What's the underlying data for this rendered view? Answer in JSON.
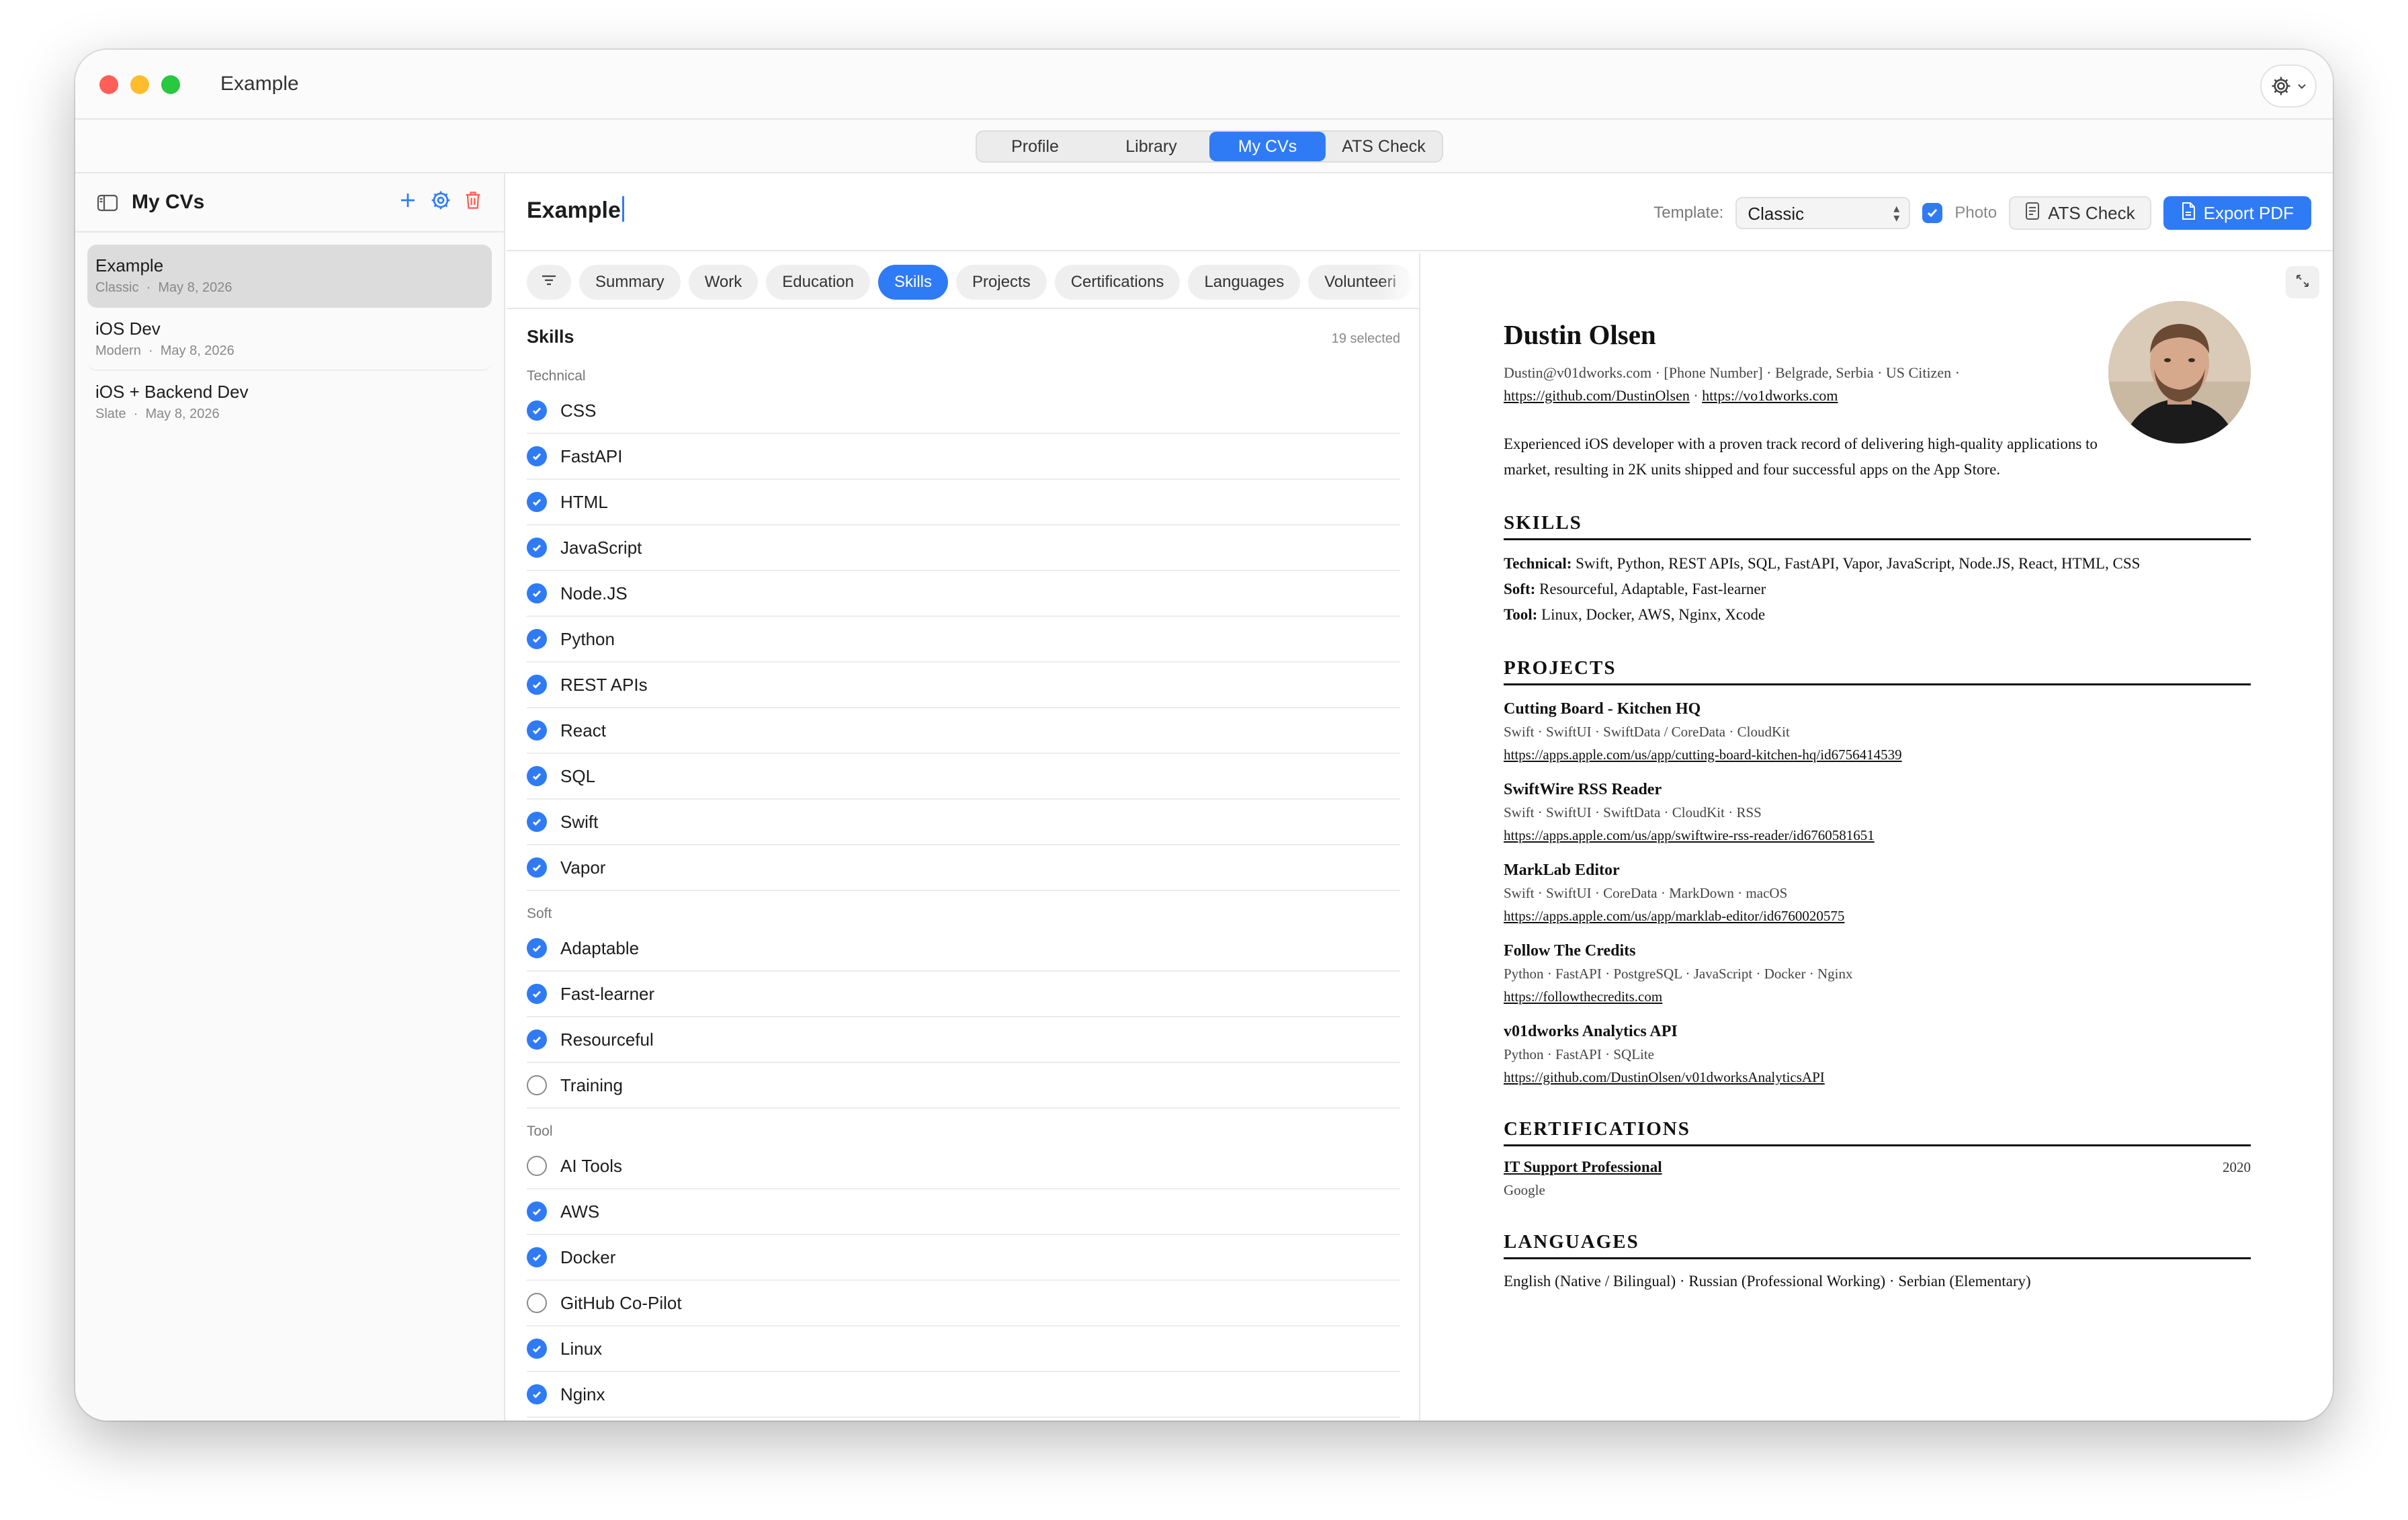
{
  "window": {
    "title": "Example"
  },
  "nav": {
    "segments": [
      {
        "label": "Profile",
        "active": false
      },
      {
        "label": "Library",
        "active": false
      },
      {
        "label": "My CVs",
        "active": true
      },
      {
        "label": "ATS Check",
        "active": false
      }
    ]
  },
  "sidebar": {
    "title": "My CVs",
    "items": [
      {
        "name": "Example",
        "template": "Classic",
        "date": "May 8, 2026",
        "selected": true
      },
      {
        "name": "iOS Dev",
        "template": "Modern",
        "date": "May 8, 2026",
        "selected": false
      },
      {
        "name": "iOS + Backend Dev",
        "template": "Slate",
        "date": "May 8, 2026",
        "selected": false
      }
    ],
    "meta_separator": "·"
  },
  "header": {
    "doc_title": "Example",
    "template_label": "Template:",
    "template_value": "Classic",
    "photo_label": "Photo",
    "photo_checked": true,
    "ats_button": "ATS Check",
    "export_button": "Export PDF"
  },
  "tabs": [
    {
      "label": "Summary",
      "active": false
    },
    {
      "label": "Work",
      "active": false
    },
    {
      "label": "Education",
      "active": false
    },
    {
      "label": "Skills",
      "active": true
    },
    {
      "label": "Projects",
      "active": false
    },
    {
      "label": "Certifications",
      "active": false
    },
    {
      "label": "Languages",
      "active": false
    },
    {
      "label": "Volunteeri",
      "active": false
    }
  ],
  "skills_panel": {
    "title": "Skills",
    "selected_count": "19 selected",
    "groups": [
      {
        "label": "Technical",
        "skills": [
          {
            "name": "CSS",
            "checked": true
          },
          {
            "name": "FastAPI",
            "checked": true
          },
          {
            "name": "HTML",
            "checked": true
          },
          {
            "name": "JavaScript",
            "checked": true
          },
          {
            "name": "Node.JS",
            "checked": true
          },
          {
            "name": "Python",
            "checked": true
          },
          {
            "name": "REST APIs",
            "checked": true
          },
          {
            "name": "React",
            "checked": true
          },
          {
            "name": "SQL",
            "checked": true
          },
          {
            "name": "Swift",
            "checked": true
          },
          {
            "name": "Vapor",
            "checked": true
          }
        ]
      },
      {
        "label": "Soft",
        "skills": [
          {
            "name": "Adaptable",
            "checked": true
          },
          {
            "name": "Fast-learner",
            "checked": true
          },
          {
            "name": "Resourceful",
            "checked": true
          },
          {
            "name": "Training",
            "checked": false
          }
        ]
      },
      {
        "label": "Tool",
        "skills": [
          {
            "name": "AI Tools",
            "checked": false
          },
          {
            "name": "AWS",
            "checked": true
          },
          {
            "name": "Docker",
            "checked": true
          },
          {
            "name": "GitHub Co-Pilot",
            "checked": false
          },
          {
            "name": "Linux",
            "checked": true
          },
          {
            "name": "Nginx",
            "checked": true
          }
        ]
      }
    ]
  },
  "cv_preview": {
    "name": "Dustin Olsen",
    "contact_line": "Dustin@v01dworks.com · [Phone Number] · Belgrade, Serbia · US Citizen ·",
    "github": "https://github.com/DustinOlsen",
    "website": "https://vo1dworks.com",
    "link_separator": " · ",
    "summary": "Experienced iOS developer with a proven track record of delivering high-quality applications to market, resulting in 2K units shipped and four successful apps on the App Store.",
    "skills_title": "SKILLS",
    "skill_lines": [
      {
        "label": "Technical:",
        "value": "Swift, Python, REST APIs, SQL, FastAPI, Vapor, JavaScript, Node.JS, React, HTML, CSS"
      },
      {
        "label": "Soft:",
        "value": "Resourceful, Adaptable, Fast-learner"
      },
      {
        "label": "Tool:",
        "value": "Linux, Docker, AWS, Nginx, Xcode"
      }
    ],
    "projects_title": "PROJECTS",
    "projects": [
      {
        "name": "Cutting Board - Kitchen HQ",
        "tech": "Swift · SwiftUI · SwiftData / CoreData · CloudKit",
        "url": "https://apps.apple.com/us/app/cutting-board-kitchen-hq/id6756414539"
      },
      {
        "name": "SwiftWire RSS Reader",
        "tech": "Swift · SwiftUI · SwiftData · CloudKit · RSS",
        "url": "https://apps.apple.com/us/app/swiftwire-rss-reader/id6760581651"
      },
      {
        "name": "MarkLab Editor",
        "tech": "Swift · SwiftUI · CoreData · MarkDown · macOS",
        "url": "https://apps.apple.com/us/app/marklab-editor/id6760020575"
      },
      {
        "name": "Follow The Credits",
        "tech": "Python · FastAPI · PostgreSQL · JavaScript · Docker · Nginx",
        "url": "https://followthecredits.com"
      },
      {
        "name": "v01dworks Analytics API",
        "tech": "Python · FastAPI · SQLite",
        "url": "https://github.com/DustinOlsen/v01dworksAnalyticsAPI"
      }
    ],
    "certifications_title": "CERTIFICATIONS",
    "certifications": [
      {
        "name": "IT Support Professional",
        "year": "2020",
        "issuer": "Google"
      }
    ],
    "languages_title": "LANGUAGES",
    "languages_line": "English (Native / Bilingual) · Russian (Professional Working) · Serbian (Elementary)"
  },
  "colors": {
    "accent": "#2f7bf5",
    "destructive": "#ff5f57"
  },
  "icons": {
    "gear": "gear-icon",
    "sidebar_toggle": "sidebar-toggle-icon",
    "add": "plus-icon",
    "settings": "gear-icon",
    "delete": "trash-icon",
    "filter": "filter-lines-icon",
    "expand": "expand-arrows-icon",
    "ats": "document-icon",
    "export": "pdf-document-icon"
  }
}
